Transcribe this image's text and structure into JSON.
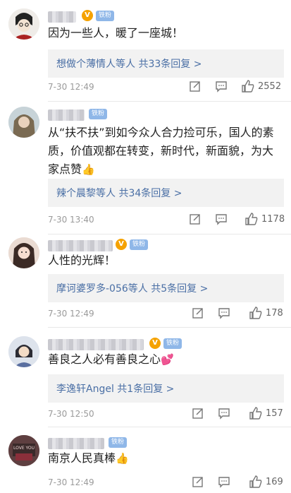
{
  "badges": {
    "fan": "铁粉"
  },
  "comments": [
    {
      "text": "因为一些人，暖了一座城！",
      "reply": "想做个薄情人等人  共33条回复 >",
      "time": "7-30 12:49",
      "likes": "2552"
    },
    {
      "text": "从“扶不扶”到如今众人合力捡可乐，国人的素质，价值观都在转变，新时代，新面貌，为大家点赞",
      "reply": "辣个晨黎等人  共34条回复 >",
      "time": "7-30 13:40",
      "likes": "1178"
    },
    {
      "text": "人性的光辉！",
      "reply": "摩诃婆罗多-056等人  共5条回复 >",
      "time": "7-30 12:49",
      "likes": "178"
    },
    {
      "text": "善良之人必有善良之心",
      "reply": "李逸轩Angel  共1条回复 >",
      "time": "7-30 12:50",
      "likes": "157"
    },
    {
      "text": "南京人民真棒",
      "time": "7-30 12:49",
      "likes": "169"
    }
  ],
  "avatar_labels": {
    "c5": "LOVE YOU"
  },
  "colors": {
    "link": "#4a6fa5",
    "reply_bg": "#f2f2f2",
    "v_badge": "#f5a200",
    "fan_badge": "#8fb7e8"
  }
}
